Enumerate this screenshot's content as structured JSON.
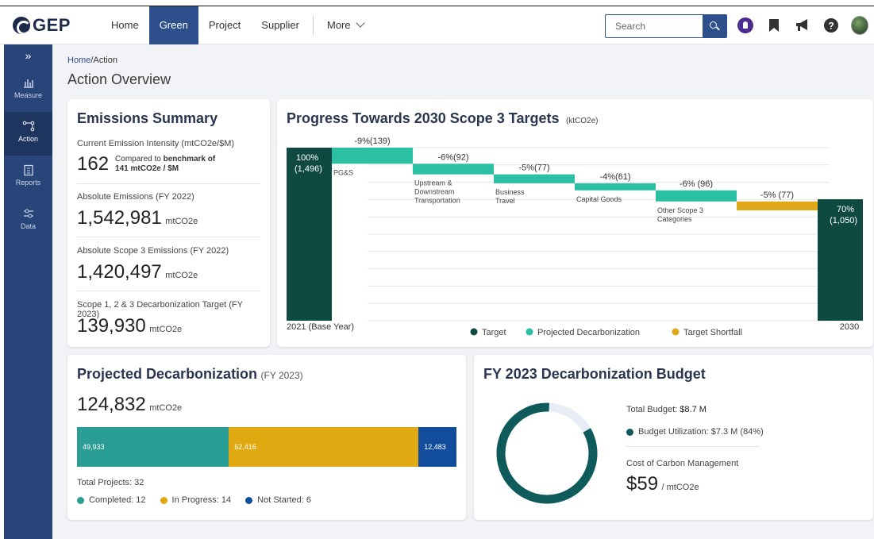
{
  "header": {
    "logo": "GEP",
    "nav": [
      "Home",
      "Green",
      "Project",
      "Supplier"
    ],
    "more": "More",
    "search_placeholder": "Search"
  },
  "sidebar": {
    "items": [
      {
        "label": "Measure",
        "icon": "bar-chart-icon"
      },
      {
        "label": "Action",
        "icon": "flow-icon"
      },
      {
        "label": "Reports",
        "icon": "clipboard-icon"
      },
      {
        "label": "Data",
        "icon": "sliders-icon"
      }
    ]
  },
  "breadcrumb": {
    "home": "Home",
    "current": "/Action"
  },
  "page_title": "Action Overview",
  "emissions": {
    "title": "Emissions Summary",
    "intensity_label": "Current Emission Intensity (mtCO2e/$M)",
    "intensity_value": "162",
    "compare_prefix": "Compared to ",
    "compare_bold": "benchmark of",
    "compare_line2": "141 mtCO2e / $M",
    "abs_label": "Absolute Emissions (FY 2022)",
    "abs_value": "1,542,981",
    "scope3_label": "Absolute Scope 3 Emissions (FY 2022)",
    "scope3_value": "1,420,497",
    "target_label": "Scope 1, 2 & 3 Decarbonization Target (FY 2023)",
    "target_value": "139,930",
    "unit": "mtCO2e"
  },
  "progress": {
    "title": "Progress Towards 2030 Scope 3 Targets",
    "unit": "(ktCO2e)"
  },
  "chart_data": {
    "type": "bar",
    "subtype": "waterfall",
    "title": "Progress Towards 2030 Scope 3 Targets",
    "unit": "(ktCO2e)",
    "categories": [
      "2021 (Base Year)",
      "PG&S",
      "Upstream & Downstream Transportation",
      "Business Travel",
      "Capital Goods",
      "Other Scope 3 Categories",
      "",
      "2030"
    ],
    "start": {
      "label": "2021 (Base Year)",
      "value": 1496,
      "pct": "100%",
      "display": "100%",
      "display2": "(1,496)"
    },
    "steps": [
      {
        "label": "PG&S",
        "value": 139,
        "display": "-9%(139)",
        "kind": "Projected Decarbonization"
      },
      {
        "label": "Upstream & Downstream Transportation",
        "value": 92,
        "display": "-6%(92)",
        "kind": "Projected Decarbonization"
      },
      {
        "label": "Business Travel",
        "value": 77,
        "display": "-5%(77)",
        "kind": "Projected Decarbonization"
      },
      {
        "label": "Capital Goods",
        "value": 61,
        "display": "-4%(61)",
        "kind": "Projected Decarbonization"
      },
      {
        "label": "Other Scope 3 Categories",
        "value": 96,
        "display": "-6% (96)",
        "kind": "Projected Decarbonization"
      },
      {
        "label": "",
        "value": 77,
        "display": "-5% (77)",
        "kind": "Target Shortfall"
      }
    ],
    "end": {
      "label": "2030",
      "value": 1050,
      "display": "70%",
      "display2": "(1,050)"
    },
    "legend": [
      {
        "name": "Target",
        "color": "#0f4a42"
      },
      {
        "name": "Projected Decarbonization",
        "color": "#2bbfa3"
      },
      {
        "name": "Target Shortfall",
        "color": "#dfa91a"
      }
    ],
    "legend_position": "bottom",
    "grid": true
  },
  "projected": {
    "title": "Projected Decarbonization",
    "suffix": "(FY 2023)",
    "value": "124,832",
    "unit": "mtCO2e",
    "segments": [
      {
        "name": "Completed",
        "value": 49933,
        "label": "49,933",
        "color": "#2a9d94"
      },
      {
        "name": "In Progress",
        "value": 62416,
        "label": "62,416",
        "color": "#e0a911"
      },
      {
        "name": "Not Started",
        "value": 12483,
        "label": "12,483",
        "color": "#114d9c"
      }
    ],
    "total_projects_label": "Total Projects: 32",
    "legend": [
      {
        "label": "Completed: 12",
        "color": "#2a9d94"
      },
      {
        "label": "In Progress: 14",
        "color": "#e0a911"
      },
      {
        "label": "Not Started: 6",
        "color": "#114d9c"
      }
    ]
  },
  "budget": {
    "title": "FY 2023 Decarbonization Budget",
    "total_label": "Total Budget: ",
    "total_value": "$8.7 M",
    "utilization_label": "Budget Utilization: $7.3 M (84%)",
    "utilization_pct": 0.84,
    "ring_color": "#0f5a5a",
    "cost_label": "Cost of Carbon Management",
    "cost_value": "$59",
    "cost_unit": "/ mtCO2e"
  }
}
